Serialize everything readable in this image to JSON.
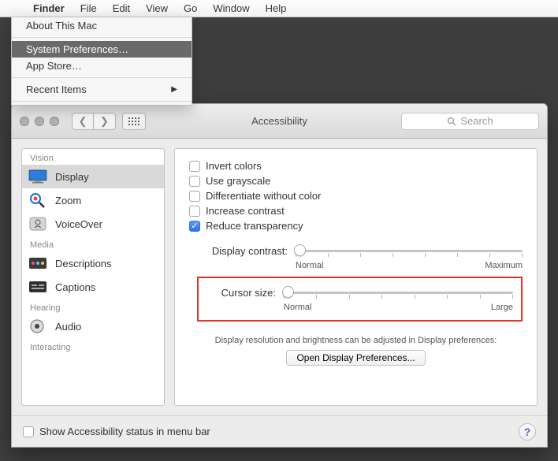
{
  "menubar": {
    "app": "Finder",
    "items": [
      "File",
      "Edit",
      "View",
      "Go",
      "Window",
      "Help"
    ]
  },
  "apple_menu": {
    "about": "About This Mac",
    "sysprefs": "System Preferences…",
    "appstore": "App Store…",
    "recent": "Recent Items"
  },
  "window": {
    "title": "Accessibility",
    "search_placeholder": "Search"
  },
  "sidebar": {
    "groups": [
      {
        "label": "Vision",
        "items": [
          "Display",
          "Zoom",
          "VoiceOver"
        ],
        "selected": 0
      },
      {
        "label": "Media",
        "items": [
          "Descriptions",
          "Captions"
        ]
      },
      {
        "label": "Hearing",
        "items": [
          "Audio"
        ]
      },
      {
        "label": "Interacting",
        "items": []
      }
    ]
  },
  "options": {
    "invert": "Invert colors",
    "grayscale": "Use grayscale",
    "diff": "Differentiate without color",
    "contrast": "Increase contrast",
    "reduce": "Reduce transparency"
  },
  "sliders": {
    "contrast_label": "Display contrast:",
    "contrast_min": "Normal",
    "contrast_max": "Maximum",
    "cursor_label": "Cursor size:",
    "cursor_min": "Normal",
    "cursor_max": "Large"
  },
  "help_text": "Display resolution and brightness can be adjusted in Display preferences:",
  "open_button": "Open Display Preferences...",
  "footer_checkbox": "Show Accessibility status in menu bar"
}
